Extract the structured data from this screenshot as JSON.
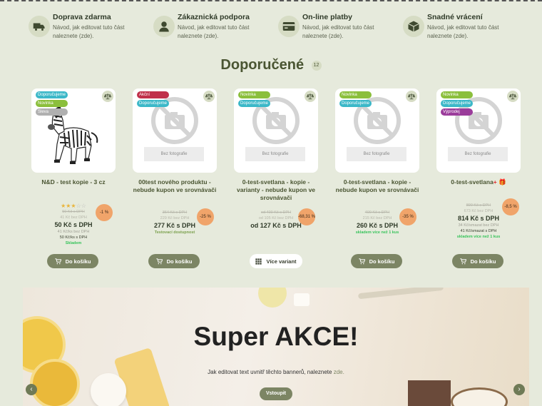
{
  "benefits": [
    {
      "title": "Doprava zdarma",
      "text": "Návod, jak editovat tuto část naleznete (zde).",
      "icon": "truck-icon"
    },
    {
      "title": "Zákaznická podpora",
      "text": "Návod, jak editovat tuto část naleznete (zde).",
      "icon": "user-icon"
    },
    {
      "title": "On-line platby",
      "text": "Návod, jak editovat tuto část naleznete (zde).",
      "icon": "credit-card-icon"
    },
    {
      "title": "Snadné vrácení",
      "text": "Návod, jak editovat tuto část naleznete (zde).",
      "icon": "box-icon"
    }
  ],
  "section": {
    "title": "Doporučené",
    "count": "12"
  },
  "colors": {
    "accent": "#7c8564",
    "discount": "#f0a46a",
    "instock": "#37c35a",
    "bg": "#e6eadc"
  },
  "flag_colors": {
    "Doporučujeme": "#3cb8c8",
    "Novinka": "#8bbf3c",
    "Sleva": "#b0b0b0",
    "Akční": "#c0304a",
    "Výprodej": "#9b3c9b"
  },
  "products": [
    {
      "name": "N&D - test kopie - 3 cz",
      "flags": [
        "Doporučujeme",
        "Novinka",
        "Sleva"
      ],
      "has_photo": true,
      "rating": 3,
      "old_price": "50 Kč s DPH",
      "old_price_net": "41 Kč bez DPH",
      "price": "50 Kč s DPH",
      "price_net": "41 Kč/ks bez DPH",
      "unit_price": "50 Kč/ks s DPH",
      "stock": "Skladem",
      "discount": "-1 %",
      "button": "Do košíku"
    },
    {
      "name": "00test nového produktu - nebude kupon ve srovnávači",
      "flags": [
        "Akční",
        "Doporučujeme"
      ],
      "has_photo": false,
      "no_photo_label": "Bez fotografie",
      "old_price": "364 Kč s DPH",
      "old_price_net": "229 Kč bez DPH",
      "price": "277 Kč s DPH",
      "price_net": "",
      "unit_price": "",
      "stock": "Testovací dostupnost",
      "discount": "-25 %",
      "button": "Do košíku"
    },
    {
      "name": "0-test-svetlana - kopie - varianty - nebude kupon ve srovnávači",
      "flags": [
        "Novinka",
        "Doporučujeme"
      ],
      "has_photo": false,
      "no_photo_label": "Bez fotografie",
      "old_price": "od 400 Kč s DPH",
      "old_price_net": "od 105 Kč bez DPH",
      "price": "od 127 Kč s DPH",
      "price_net": "",
      "unit_price": "",
      "stock": "",
      "discount": "-68,31 %",
      "button": "Více variant"
    },
    {
      "name": "0-test-svetlana - kopie - nebude kupon ve srovnávači",
      "flags": [
        "Novinka",
        "Doporučujeme"
      ],
      "has_photo": false,
      "no_photo_label": "Bez fotografie",
      "old_price": "400 Kč s DPH",
      "old_price_net": "215 Kč bez DPH",
      "price": "260 Kč s DPH",
      "price_net": "",
      "unit_price": "",
      "stock": "skladem více než 1 kus",
      "discount": "-35 %",
      "button": "Do košíku"
    },
    {
      "name": "0-test-svetlana",
      "name_suffix": "+",
      "flags": [
        "Novinka",
        "Doporučujeme",
        "Výprodej"
      ],
      "has_photo": false,
      "no_photo_label": "Bez fotografie",
      "old_price": "890 Kč s DPH",
      "old_price_net": "673 Kč bez DPH",
      "price": "814 Kč s DPH",
      "price_net": "34 Kč/smazat bez DPH",
      "unit_price": "41 Kč/smazat s DPH",
      "stock": "skladem více než 1 kus",
      "discount": "-8,5 %",
      "button": "Do košíku"
    }
  ],
  "banner": {
    "title": "Super AKCE!",
    "text": "Jak editovat text uvnitř těchto bannerů, naleznete",
    "link": "zde.",
    "button": "Vstoupit",
    "prev": "‹",
    "next": "›"
  }
}
